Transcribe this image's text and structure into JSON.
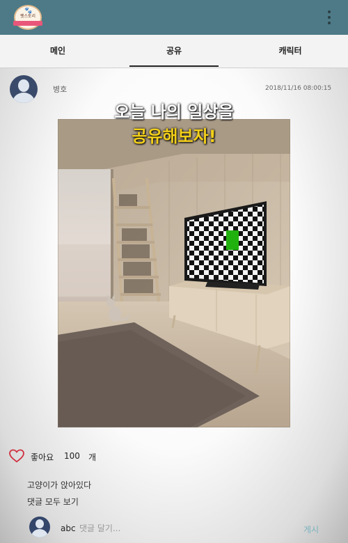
{
  "app": {
    "logo_text": "펫스토리",
    "menu_icon": "more-vertical-icon",
    "bar_color": "#4d7a86"
  },
  "tabs": [
    {
      "label": "메인",
      "active": false
    },
    {
      "label": "공유",
      "active": true
    },
    {
      "label": "캐릭터",
      "active": false
    }
  ],
  "post": {
    "author": "병호",
    "timestamp": "2018/11/16 08:00:15",
    "caption_line1": "오늘 나의 일상을",
    "caption_line2": "공유해보자!",
    "caption_highlight_color": "#f2cf1a",
    "like_label": "좋아요",
    "like_count": "100",
    "like_unit": "개",
    "text": "고양이가 앉아있다",
    "view_comments": "댓글 모두 보기"
  },
  "comment": {
    "user": "abc",
    "placeholder": "댓글 달기...",
    "submit_label": "게시",
    "submit_color": "#7ab3bf"
  }
}
